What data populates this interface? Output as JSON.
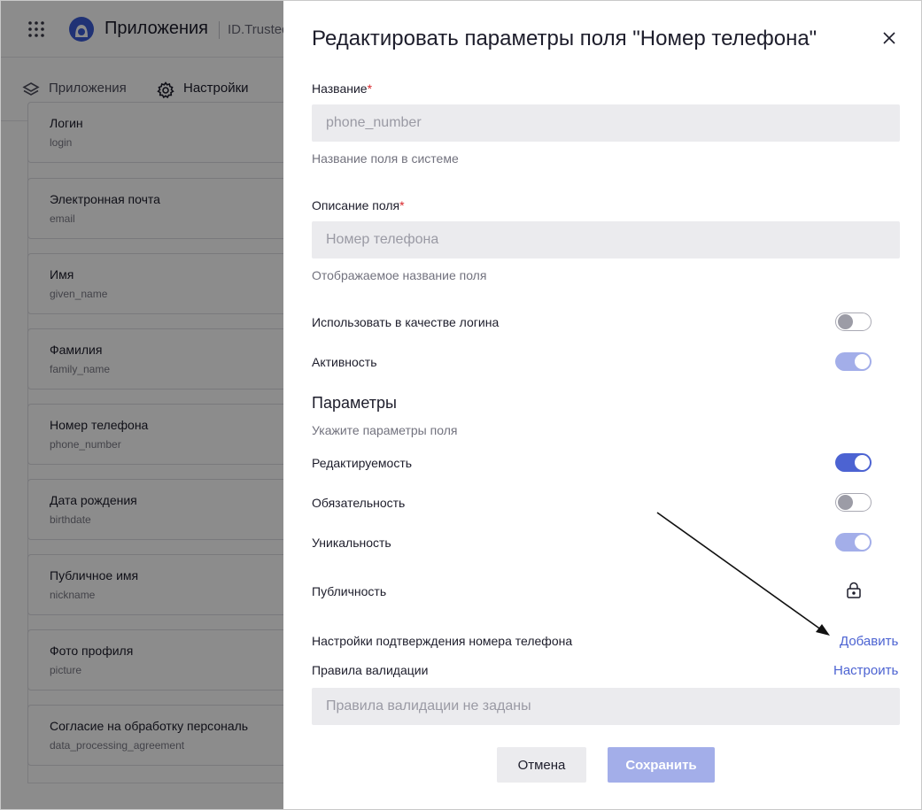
{
  "app": {
    "title": "Приложения",
    "id_text": "ID.Trusted",
    "tabs": [
      {
        "label": "Приложения"
      },
      {
        "label": "Настройки"
      }
    ]
  },
  "fields": [
    {
      "label": "Логин",
      "key": "login"
    },
    {
      "label": "Электронная почта",
      "key": "email"
    },
    {
      "label": "Имя",
      "key": "given_name"
    },
    {
      "label": "Фамилия",
      "key": "family_name"
    },
    {
      "label": "Номер телефона",
      "key": "phone_number"
    },
    {
      "label": "Дата рождения",
      "key": "birthdate"
    },
    {
      "label": "Публичное имя",
      "key": "nickname"
    },
    {
      "label": "Фото профиля",
      "key": "picture"
    },
    {
      "label": "Согласие на обработку персональ",
      "key": "data_processing_agreement"
    }
  ],
  "drawer": {
    "title": "Редактировать параметры поля \"Номер телефона\"",
    "name_label": "Название",
    "required_mark": "*",
    "name_value": "phone_number",
    "name_hint": "Название поля в системе",
    "desc_label": "Описание поля",
    "desc_value": "Номер телефона",
    "desc_hint": "Отображаемое название поля",
    "use_as_login_label": "Использовать в качестве логина",
    "use_as_login_on": false,
    "active_label": "Активность",
    "active_on": true,
    "params_title": "Параметры",
    "params_hint": "Укажите параметры поля",
    "editable_label": "Редактируемость",
    "editable_on": true,
    "required_label": "Обязательность",
    "required_on": false,
    "unique_label": "Уникальность",
    "unique_on": true,
    "public_label": "Публичность",
    "confirm_label": "Настройки подтверждения номера телефона",
    "confirm_link": "Добавить",
    "validation_label": "Правила валидации",
    "validation_link": "Настроить",
    "validation_value": "Правила валидации не заданы",
    "cancel_label": "Отмена",
    "save_label": "Сохранить"
  },
  "colors": {
    "accent": "#4c63d2",
    "accent_light": "#a3aee9",
    "required": "#d8262b"
  }
}
